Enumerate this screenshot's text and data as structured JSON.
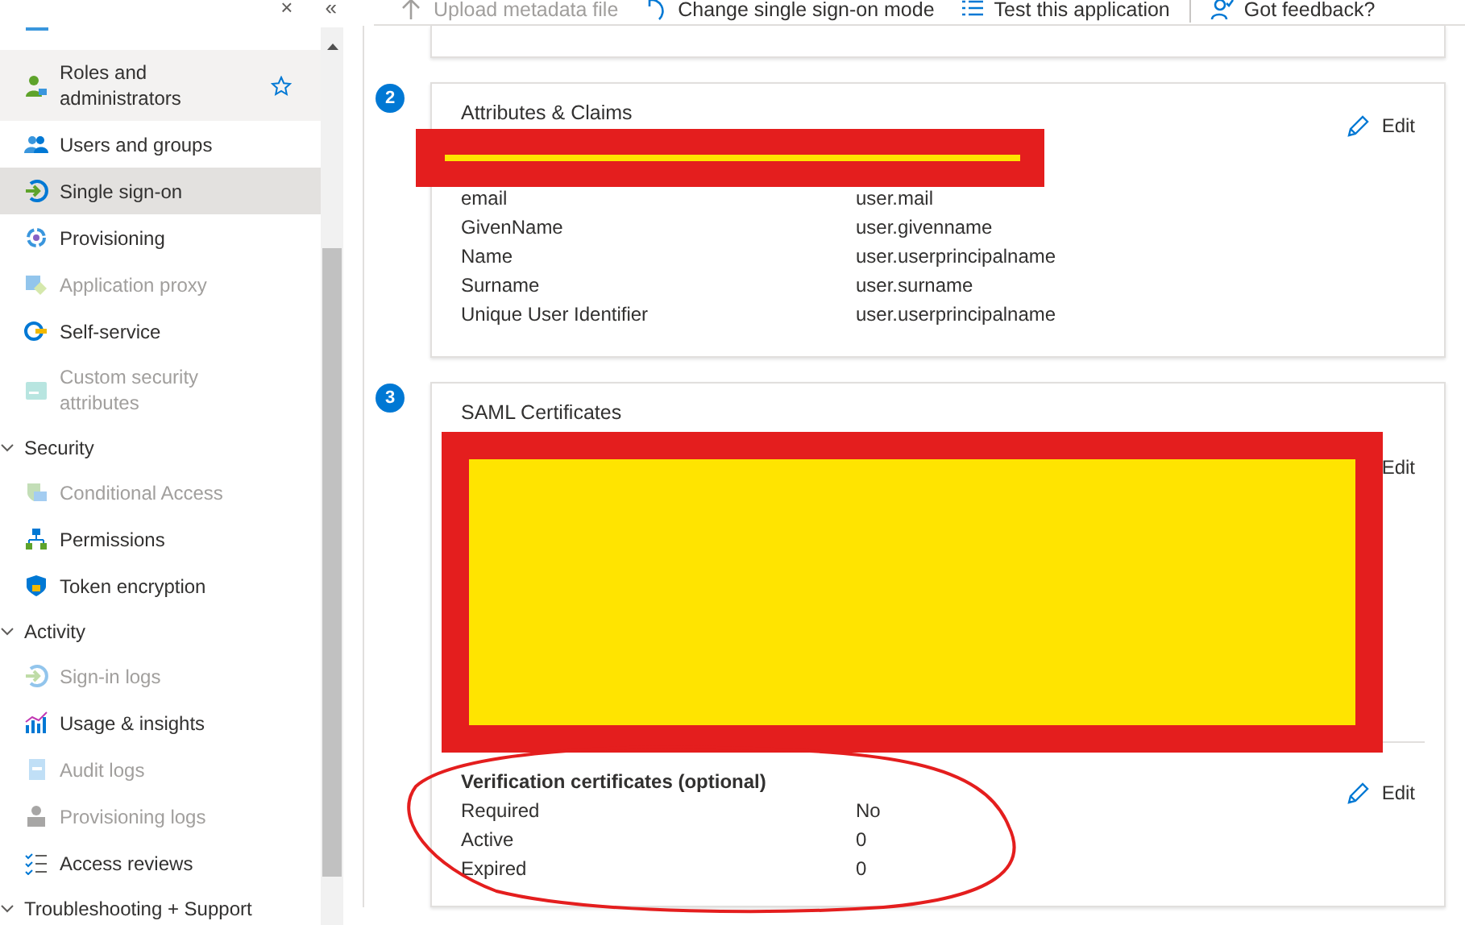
{
  "sidebar": {
    "close": "×",
    "collapse": "«",
    "items": [
      {
        "kind": "item",
        "label": "Roles and administrators",
        "selected": false,
        "hovered": true,
        "disabled": false,
        "favorite": true
      },
      {
        "kind": "item",
        "label": "Users and groups",
        "selected": false,
        "hovered": false,
        "disabled": false,
        "favorite": false
      },
      {
        "kind": "item",
        "label": "Single sign-on",
        "selected": true,
        "hovered": false,
        "disabled": false,
        "favorite": false
      },
      {
        "kind": "item",
        "label": "Provisioning",
        "selected": false,
        "hovered": false,
        "disabled": false,
        "favorite": false
      },
      {
        "kind": "item",
        "label": "Application proxy",
        "selected": false,
        "hovered": false,
        "disabled": true,
        "favorite": false
      },
      {
        "kind": "item",
        "label": "Self-service",
        "selected": false,
        "hovered": false,
        "disabled": false,
        "favorite": false
      },
      {
        "kind": "item",
        "label": "Custom security attributes",
        "selected": false,
        "hovered": false,
        "disabled": true,
        "favorite": false
      },
      {
        "kind": "section",
        "label": "Security",
        "expanded": true
      },
      {
        "kind": "item",
        "label": "Conditional Access",
        "selected": false,
        "hovered": false,
        "disabled": true,
        "favorite": false
      },
      {
        "kind": "item",
        "label": "Permissions",
        "selected": false,
        "hovered": false,
        "disabled": false,
        "favorite": false
      },
      {
        "kind": "item",
        "label": "Token encryption",
        "selected": false,
        "hovered": false,
        "disabled": false,
        "favorite": false
      },
      {
        "kind": "section",
        "label": "Activity",
        "expanded": true
      },
      {
        "kind": "item",
        "label": "Sign-in logs",
        "selected": false,
        "hovered": false,
        "disabled": true,
        "favorite": false
      },
      {
        "kind": "item",
        "label": "Usage & insights",
        "selected": false,
        "hovered": false,
        "disabled": false,
        "favorite": false
      },
      {
        "kind": "item",
        "label": "Audit logs",
        "selected": false,
        "hovered": false,
        "disabled": true,
        "favorite": false
      },
      {
        "kind": "item",
        "label": "Provisioning logs",
        "selected": false,
        "hovered": false,
        "disabled": true,
        "favorite": false
      },
      {
        "kind": "item",
        "label": "Access reviews",
        "selected": false,
        "hovered": false,
        "disabled": false,
        "favorite": false
      },
      {
        "kind": "section",
        "label": "Troubleshooting + Support",
        "expanded": true
      }
    ]
  },
  "toolbar": [
    {
      "label": "Upload metadata file",
      "disabled": true
    },
    {
      "label": "Change single sign-on mode",
      "disabled": false
    },
    {
      "label": "Test this application",
      "disabled": false
    },
    {
      "label": "Got feedback?",
      "disabled": false
    }
  ],
  "steps": [
    {
      "number": "2",
      "title": "Attributes & Claims",
      "edit": "Edit",
      "edit_icon": true,
      "rows": [
        {
          "label": "email",
          "value": "user.mail"
        },
        {
          "label": "GivenName",
          "value": "user.givenname"
        },
        {
          "label": "Name",
          "value": "user.userprincipalname"
        },
        {
          "label": "Surname",
          "value": "user.surname"
        },
        {
          "label": "Unique User Identifier",
          "value": "user.userprincipalname"
        }
      ]
    },
    {
      "number": "3",
      "title": "SAML Certificates",
      "edit": "Edit",
      "edit_icon": false,
      "subsection": {
        "title": "Verification certificates (optional)",
        "edit": "Edit",
        "edit_icon": true,
        "rows": [
          {
            "label": "Required",
            "value": "No"
          },
          {
            "label": "Active",
            "value": "0"
          },
          {
            "label": "Expired",
            "value": "0"
          }
        ]
      }
    }
  ]
}
